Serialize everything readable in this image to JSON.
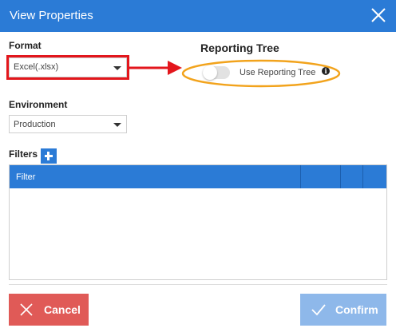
{
  "dialog": {
    "title": "View Properties"
  },
  "format": {
    "label": "Format",
    "selected": "Excel(.xlsx)"
  },
  "reporting_tree": {
    "heading": "Reporting Tree",
    "toggle_label": "Use Reporting Tree",
    "toggle_on": false
  },
  "environment": {
    "label": "Environment",
    "selected": "Production"
  },
  "filters": {
    "label": "Filters",
    "columns": [
      "Filter",
      "",
      "",
      ""
    ]
  },
  "footer": {
    "cancel_label": "Cancel",
    "confirm_label": "Confirm"
  },
  "colors": {
    "accent": "#2b7bd6",
    "cancel": "#e05a57",
    "confirm_disabled": "#8eb8ea",
    "highlight_red": "#e3161c",
    "highlight_orange": "#f2a31c"
  },
  "icons": {
    "close": "close-icon",
    "plus": "plus-icon",
    "info": "info-icon",
    "cancel": "x-icon",
    "confirm": "check-icon",
    "select_caret": "caret-down-icon"
  }
}
